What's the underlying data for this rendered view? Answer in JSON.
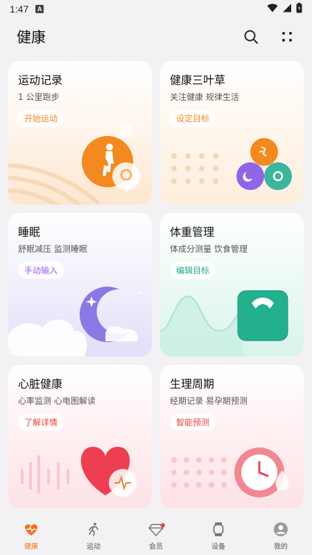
{
  "status": {
    "time": "1:47",
    "app_badge": "A"
  },
  "header": {
    "title": "健康"
  },
  "cards": [
    {
      "title": "运动记录",
      "sub": "1 公里跑步",
      "button": "开始运动",
      "color": "#f08a2a"
    },
    {
      "title": "健康三叶草",
      "sub": "关注健康 规律生活",
      "button": "设定目标",
      "color": "#f08a2a"
    },
    {
      "title": "睡眠",
      "sub": "舒眠减压 监测睡眠",
      "button": "手动输入",
      "color": "#9b5de5"
    },
    {
      "title": "体重管理",
      "sub": "体成分测量 饮食管理",
      "button": "编辑目标",
      "color": "#22a88a"
    },
    {
      "title": "心脏健康",
      "sub": "心率监测 心电图解读",
      "button": "了解详情",
      "color": "#e8453c"
    },
    {
      "title": "生理周期",
      "sub": "经期记录 易孕期预测",
      "button": "智能预测",
      "color": "#e8453c"
    }
  ],
  "nav": [
    {
      "label": "健康",
      "icon": "heart-pulse-icon",
      "active": true
    },
    {
      "label": "运动",
      "icon": "runner-icon",
      "active": false
    },
    {
      "label": "会员",
      "icon": "diamond-icon",
      "active": false,
      "badge": true
    },
    {
      "label": "设备",
      "icon": "watch-icon",
      "active": false
    },
    {
      "label": "我的",
      "icon": "profile-icon",
      "active": false
    }
  ],
  "colors": {
    "accent": "#f2711c"
  }
}
